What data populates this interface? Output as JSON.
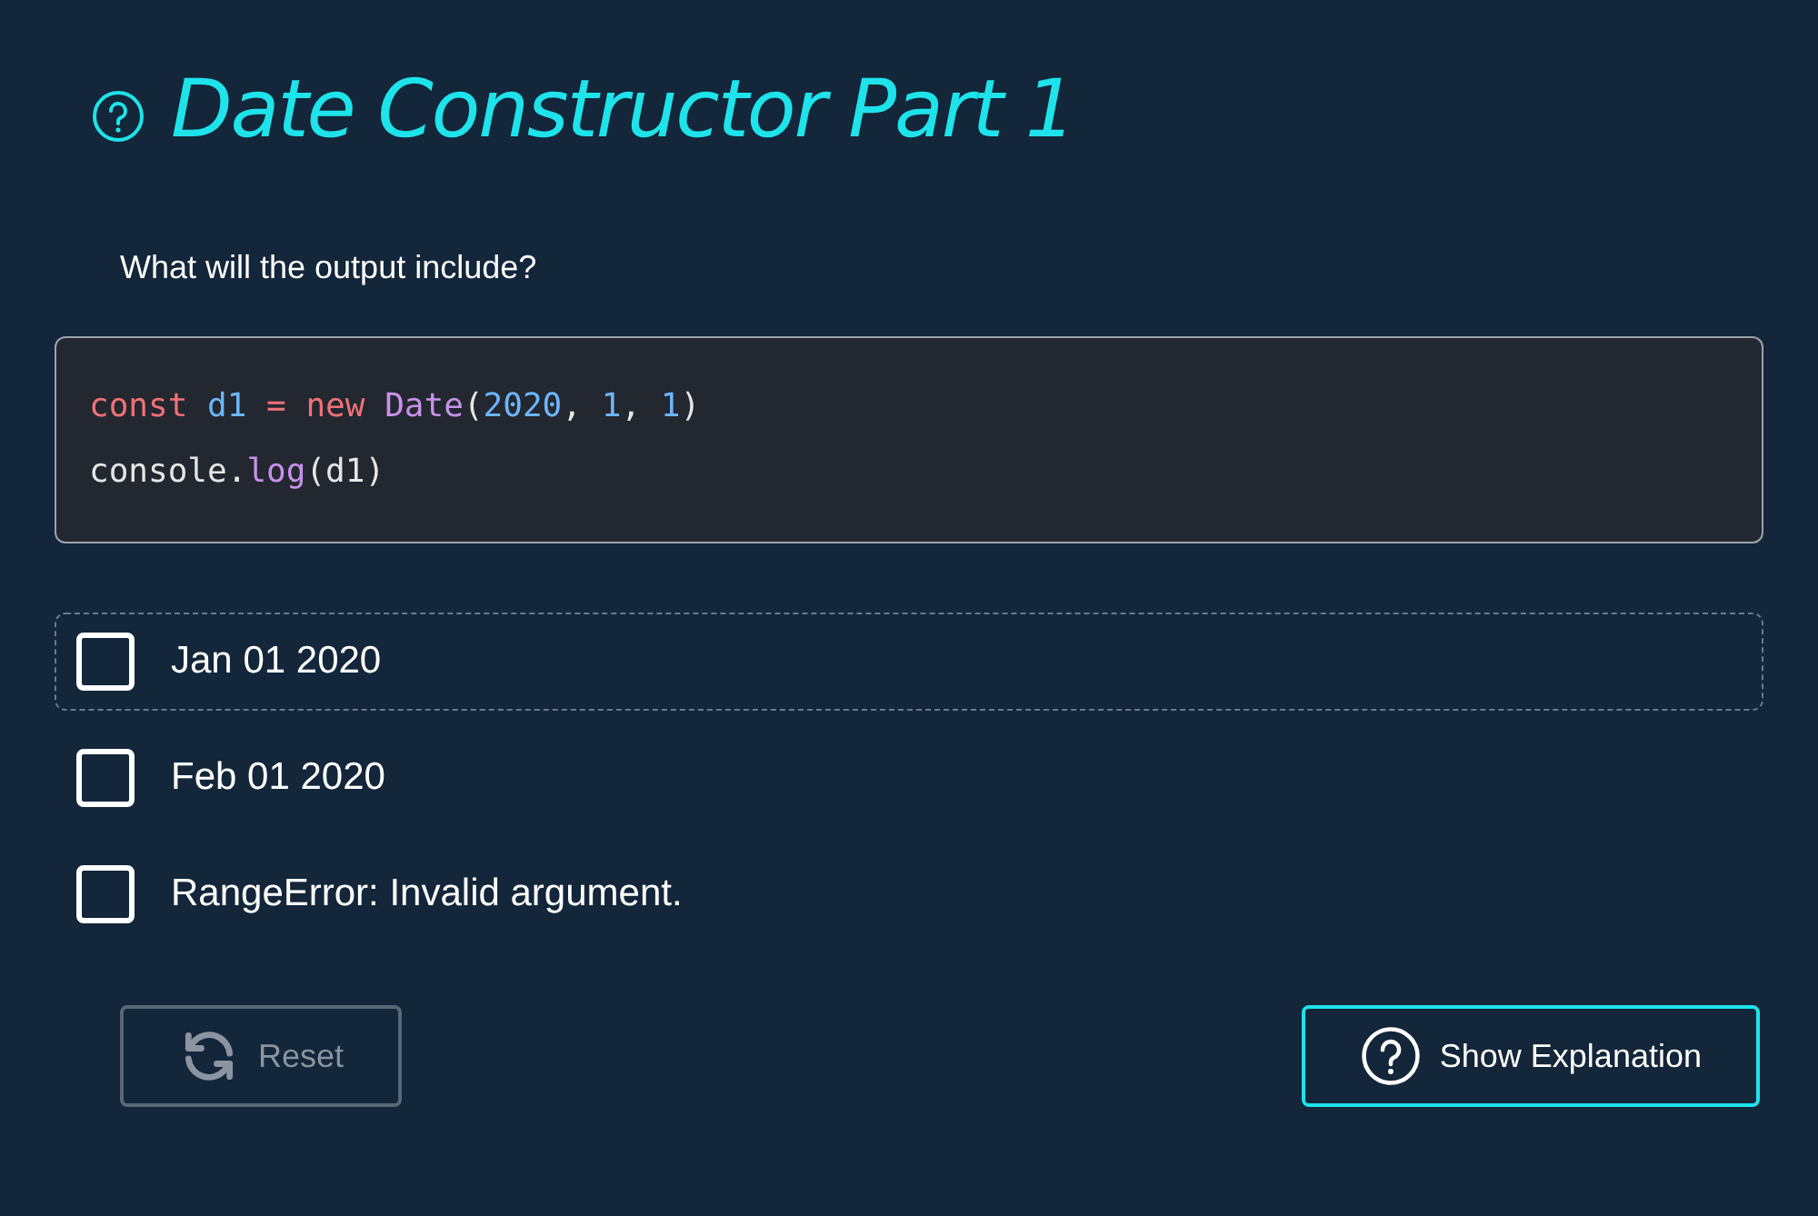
{
  "title": "Date Constructor Part 1",
  "question": "What will the output include?",
  "code": [
    [
      {
        "kind": "keyword",
        "text": "const "
      },
      {
        "kind": "variable",
        "text": "d1 "
      },
      {
        "kind": "keyword",
        "text": "= new "
      },
      {
        "kind": "class",
        "text": "Date"
      },
      {
        "kind": "plain",
        "text": "("
      },
      {
        "kind": "number",
        "text": "2020"
      },
      {
        "kind": "plain",
        "text": ", "
      },
      {
        "kind": "number",
        "text": "1"
      },
      {
        "kind": "plain",
        "text": ", "
      },
      {
        "kind": "number",
        "text": "1"
      },
      {
        "kind": "plain",
        "text": ")"
      }
    ],
    [
      {
        "kind": "plain",
        "text": "console."
      },
      {
        "kind": "function",
        "text": "log"
      },
      {
        "kind": "plain",
        "text": "(d1)"
      }
    ]
  ],
  "options": [
    {
      "label": "Jan 01 2020",
      "checked": false,
      "focused": true
    },
    {
      "label": "Feb 01 2020",
      "checked": false,
      "focused": false
    },
    {
      "label": "RangeError: Invalid argument.",
      "checked": false,
      "focused": false
    }
  ],
  "buttons": [
    {
      "kind": "reset",
      "label": "Reset",
      "disabled": true
    },
    {
      "kind": "explain",
      "label": "Show Explanation",
      "disabled": false
    }
  ]
}
